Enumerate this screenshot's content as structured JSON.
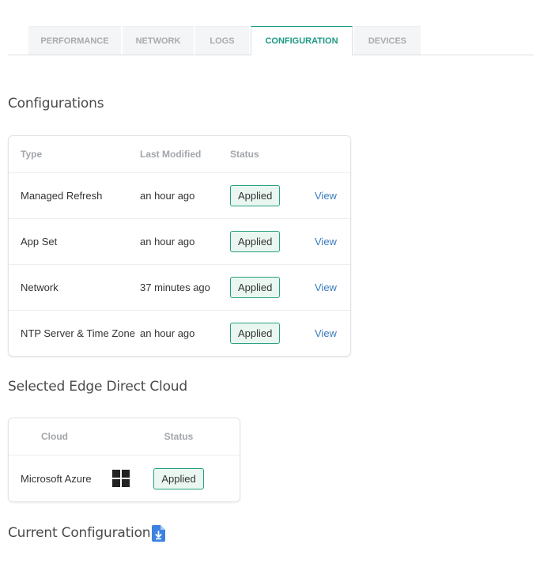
{
  "tabs": [
    {
      "label": "PERFORMANCE"
    },
    {
      "label": "NETWORK"
    },
    {
      "label": "LOGS"
    },
    {
      "label": "CONFIGURATION",
      "active": true
    },
    {
      "label": "DEVICES"
    }
  ],
  "configurations": {
    "title": "Configurations",
    "headers": {
      "type": "Type",
      "last_modified": "Last Modified",
      "status": "Status"
    },
    "rows": [
      {
        "type": "Managed Refresh",
        "last_modified": "an hour ago",
        "status": "Applied",
        "action": "View"
      },
      {
        "type": "App Set",
        "last_modified": "an hour ago",
        "status": "Applied",
        "action": "View"
      },
      {
        "type": "Network",
        "last_modified": "37 minutes ago",
        "status": "Applied",
        "action": "View"
      },
      {
        "type": "NTP Server & Time Zone",
        "last_modified": "an hour ago",
        "status": "Applied",
        "action": "View"
      }
    ]
  },
  "cloud": {
    "title": "Selected Edge Direct Cloud",
    "headers": {
      "cloud": "Cloud",
      "status": "Status"
    },
    "rows": [
      {
        "name": "Microsoft Azure",
        "icon": "windows-logo-icon",
        "status": "Applied"
      }
    ]
  },
  "current_configuration": {
    "title": "Current Configuration",
    "icon": "download-document-icon"
  },
  "colors": {
    "accent": "#1d9a83",
    "badge_border": "#28a07f",
    "badge_bg": "#eaf7f1",
    "link": "#3a7bbd"
  }
}
